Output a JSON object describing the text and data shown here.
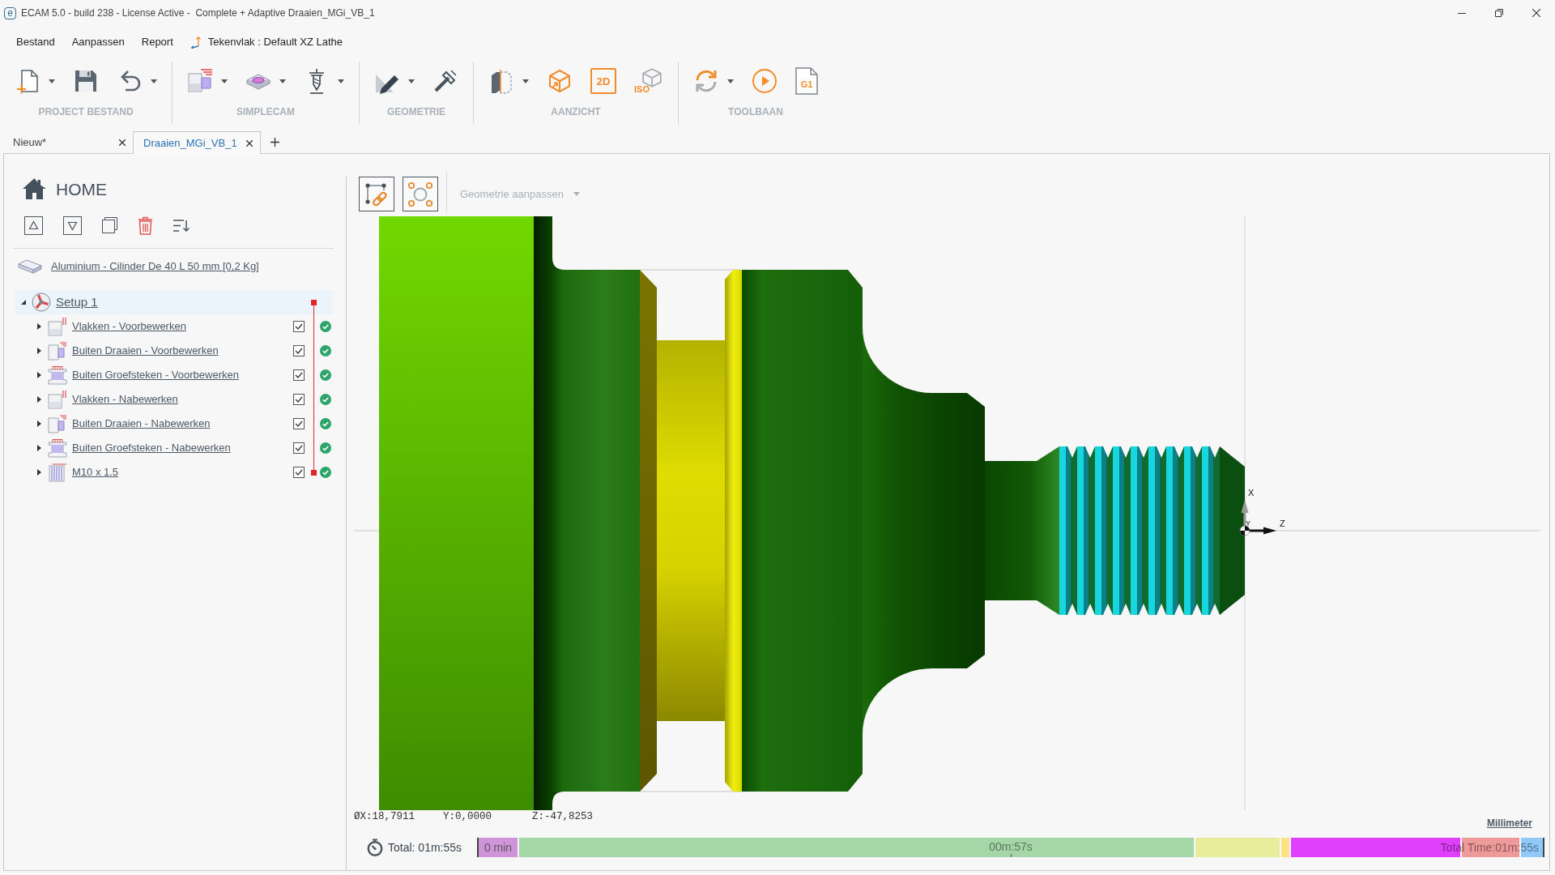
{
  "window": {
    "logo": "e",
    "title": "ECAM 5.0 - build 238 - License Active -  Complete + Adaptive Draaien_MGi_VB_1"
  },
  "menu": [
    {
      "kind": "menu",
      "label": "Bestand"
    },
    {
      "kind": "menu",
      "label": "Aanpassen"
    },
    {
      "kind": "menu",
      "label": "Report"
    },
    {
      "kind": "plane",
      "label": "Tekenvlak : Default XZ Lathe"
    }
  ],
  "ribbon": [
    {
      "label": "PROJECT BESTAND",
      "tools": [
        {
          "kind": "new",
          "dropdown": true
        },
        {
          "kind": "save",
          "dropdown": false
        },
        {
          "kind": "undo",
          "dropdown": true
        }
      ]
    },
    {
      "label": "SIMPLECAM",
      "tools": [
        {
          "kind": "turning",
          "dropdown": true
        },
        {
          "kind": "milling",
          "dropdown": true
        },
        {
          "kind": "drilling",
          "dropdown": true
        }
      ]
    },
    {
      "label": "GEOMETRIE",
      "tools": [
        {
          "kind": "sketch",
          "dropdown": true
        },
        {
          "kind": "measure",
          "dropdown": false
        }
      ]
    },
    {
      "label": "AANZICHT",
      "tools": [
        {
          "kind": "section",
          "dropdown": true
        },
        {
          "kind": "view3d",
          "dropdown": false
        },
        {
          "kind": "view2d",
          "text": "2D",
          "dropdown": false
        },
        {
          "kind": "iso",
          "text": "ISO",
          "dropdown": false
        }
      ]
    },
    {
      "label": "TOOLBAAN",
      "tools": [
        {
          "kind": "regenerate",
          "dropdown": true
        },
        {
          "kind": "simulate",
          "dropdown": false
        },
        {
          "kind": "gcode",
          "text": "G1",
          "dropdown": false
        }
      ]
    }
  ],
  "tabs": [
    {
      "label": "Nieuw*",
      "selected": false
    },
    {
      "label": "Draaien_MGi_VB_1",
      "selected": true
    }
  ],
  "project": {
    "title": "HOME",
    "stock": "Aluminium - Cilinder De 40 L 50 mm [0,2 Kg]",
    "tree": [
      {
        "kind": "setup",
        "label": "Setup 1",
        "expanded": true,
        "selected": true,
        "range_start": true,
        "children": [
          {
            "kind": "facing",
            "label": "Vlakken - Voorbewerken",
            "expanded": false,
            "selected": false,
            "checked": true,
            "completed": true
          },
          {
            "kind": "turning",
            "label": "Buiten Draaien - Voorbewerken",
            "expanded": false,
            "selected": false,
            "checked": true,
            "completed": true
          },
          {
            "kind": "grooving",
            "label": "Buiten Groefsteken - Voorbewerken",
            "expanded": false,
            "selected": false,
            "checked": true,
            "completed": true
          },
          {
            "kind": "facing",
            "label": "Vlakken - Nabewerken",
            "expanded": false,
            "selected": false,
            "checked": true,
            "completed": true
          },
          {
            "kind": "turning",
            "label": "Buiten Draaien - Nabewerken",
            "expanded": false,
            "selected": false,
            "checked": true,
            "completed": true
          },
          {
            "kind": "grooving",
            "label": "Buiten Groefsteken - Nabewerken",
            "expanded": false,
            "selected": false,
            "checked": true,
            "completed": true
          },
          {
            "kind": "threading",
            "label": "M10 x 1.5",
            "expanded": false,
            "selected": false,
            "checked": true,
            "completed": true,
            "range_end": true
          }
        ]
      }
    ]
  },
  "viewport": {
    "geometry_menu": {
      "label": "Geometrie aanpassen",
      "disabled": true
    },
    "axes": {
      "x": "X",
      "y": "Y",
      "z": "Z"
    },
    "coordinates": [
      "ØX:18,7911",
      "Y:0,0000",
      "Z:-47,8253"
    ],
    "units": "Millimeter"
  },
  "timeline": {
    "total": "Total: 01m:55s",
    "segments": [
      {
        "color": "#ce93d8",
        "label": "0 min"
      },
      {
        "color": "#a5d6a7"
      },
      {
        "color": "#e6ee9c"
      },
      {
        "color": "#ffe082"
      },
      {
        "color": "#e040fb"
      },
      {
        "color": "#ef9a9a"
      },
      {
        "color": "#90caf9"
      }
    ],
    "midpoint": "00m:57s",
    "end": "Total Time:01m:55s"
  }
}
